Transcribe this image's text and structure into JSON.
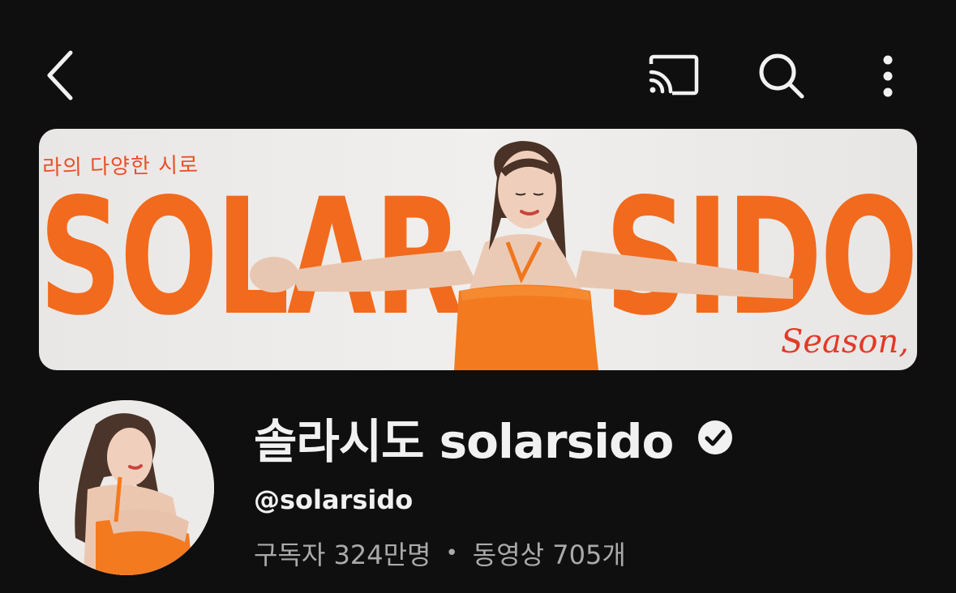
{
  "topbar": {
    "back_icon": "chevron-left-icon",
    "cast_icon": "cast-icon",
    "search_icon": "search-icon",
    "more_icon": "more-vertical-icon"
  },
  "banner": {
    "kicker": "라의 다양한 시로",
    "word_left": "SOLAR",
    "word_right": "SIDO",
    "season": "Season,",
    "accent_color": "#f26a1d"
  },
  "channel": {
    "name": "솔라시도 solarsido",
    "verified_icon": "verified-check-icon",
    "handle": "@solarsido",
    "subscribers": "구독자 324만명",
    "separator": "•",
    "videos": "동영상 705개"
  },
  "colors": {
    "background": "#0f0f0f",
    "text_primary": "#f1f1f1",
    "text_secondary": "#aaaaaa"
  }
}
